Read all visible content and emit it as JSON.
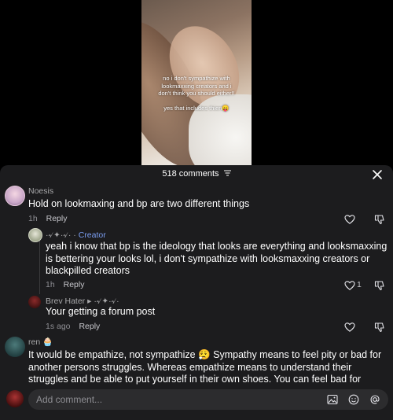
{
  "video": {
    "overlay_line1": "no i don't sympathize with lookmaxxing creators and i don't think you should either!!",
    "overlay_line2": "yes that includes thien😛"
  },
  "comments_sheet": {
    "count_label": "518 comments",
    "filter_icon": "filter-icon",
    "close_icon": "close-icon",
    "comments": [
      {
        "username": "Noesis",
        "text": "Hold on lookmaxing and bp are two different things",
        "time": "1h",
        "reply_label": "Reply",
        "likes": ""
      },
      {
        "username_decor": "·৵✦·৵·",
        "creator_label": "Creator",
        "text": "yeah i know that bp is the ideology that looks are everything and looksmaxxing is bettering your looks lol, i don't sympathize with looksmaxxing creators or blackpilled creators",
        "time": "1h",
        "reply_label": "Reply",
        "likes": "1"
      },
      {
        "username": "Brev Hater",
        "reply_to": "·৵✦·৵·",
        "text": "Your getting a forum post",
        "time": "1s ago",
        "reply_label": "Reply",
        "likes": ""
      },
      {
        "username": "ren",
        "badge": "🧁",
        "text": "It would be empathize, not sympathize 😮‍💨 Sympathy means to feel pity or bad for another persons struggles. Whereas empathize means to understand their struggles and be able to put yourself in their own shoes. You can feel bad for someone and",
        "time": "",
        "reply_label": "",
        "likes": ""
      }
    ]
  },
  "composer": {
    "placeholder": "Add comment...",
    "icons": [
      "image-icon",
      "emoji-icon",
      "mention-icon"
    ]
  },
  "colors": {
    "sheet_bg": "#1c1c1e",
    "creator_accent": "#7a9df0",
    "muted_text": "#8e8e93"
  }
}
